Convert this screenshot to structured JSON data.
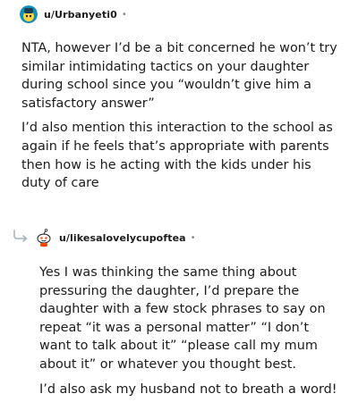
{
  "comments": [
    {
      "username": "u/Urbanyeti0",
      "dot": "•",
      "paragraphs": [
        "NTA, however I’d be a bit concerned he won’t try similar intimidating tactics on your daughter during school since you “wouldn’t give him a satisfactory answer”",
        "I’d also mention this interaction to the school as again if he feels that’s appropriate with parents then how is he acting with the kids under his duty of care"
      ]
    },
    {
      "username": "u/likesalovelycupoftea",
      "dot": "•",
      "paragraphs": [
        "Yes I was thinking the same thing about pressuring the daughter, I’d prepare the daughter with a few stock phrases to say on repeat “it was a personal matter” “I don’t want to talk about it” “please call my mum about it” or whatever you thought best.",
        "I’d also ask my husband not to breath a word!"
      ]
    }
  ],
  "colors": {
    "text": "#1c1c1c",
    "meta": "#878a8c",
    "avatar1_bg": "#0e8fb8",
    "avatar2_bg": "#ffffff",
    "reply_arrow": "#a8b3bb"
  }
}
